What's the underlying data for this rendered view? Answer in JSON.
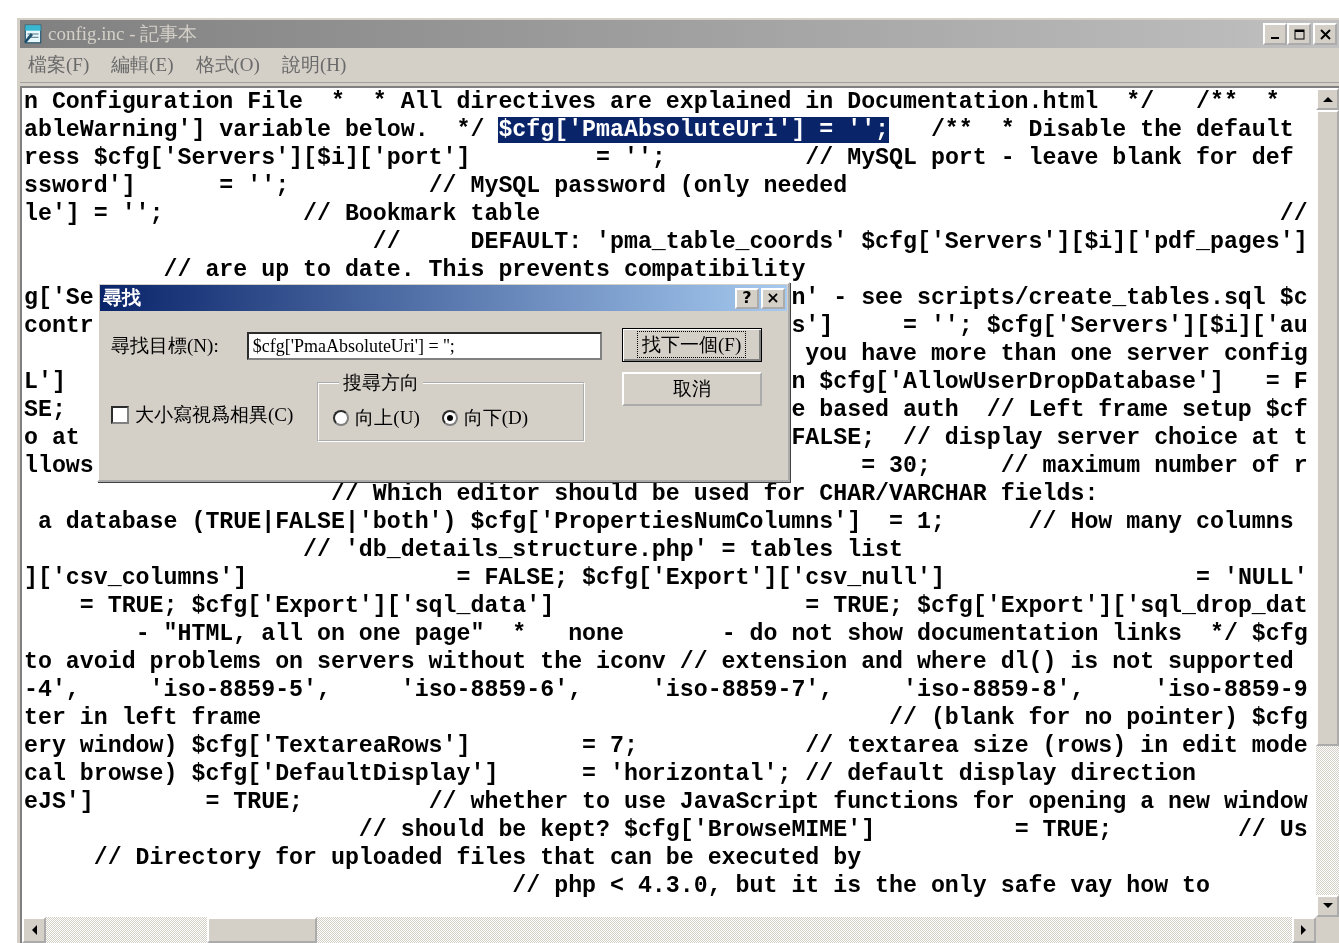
{
  "window": {
    "title": "config.inc - 記事本"
  },
  "menu": [
    "檔案(F)",
    "編輯(E)",
    "格式(O)",
    "說明(H)"
  ],
  "editor": {
    "lines": [
      [
        {
          "text": "n Configuration File  *  * All directives are explained in Documentation.html  */   /**  *",
          "selected": false
        }
      ],
      [
        {
          "text": "ableWarning'] variable below.  */ ",
          "selected": false
        },
        {
          "text": "$cfg['PmaAbsoluteUri'] = '';",
          "selected": true
        },
        {
          "text": "   /**  * Disable the default",
          "selected": false
        }
      ],
      [
        {
          "text": "ress $cfg['Servers'][$i]['port']         = '';          // MySQL port - leave blank for def",
          "selected": false
        }
      ],
      [
        {
          "text": "ssword']      = '';          // MySQL password (only needed",
          "selected": false
        }
      ],
      [
        {
          "text": "le'] = '';          // Bookmark table                                                     //",
          "selected": false
        }
      ],
      [
        {
          "text": "                         //     DEFAULT: 'pma_table_coords' $cfg['Servers'][$i]['pdf_pages']",
          "selected": false
        }
      ],
      [
        {
          "text": "          // are up to date. This prevents compatibility",
          "selected": false
        }
      ],
      [
        {
          "text": "g['Se                                                  n' - see scripts/create_tables.sql $c",
          "selected": false
        }
      ],
      [
        {
          "text": "contr                                                  s']     = ''; $cfg['Servers'][$i]['au",
          "selected": false
        }
      ],
      [
        {
          "text": "                                                        you have more than one server config",
          "selected": false
        }
      ],
      [
        {
          "text": "L']                                                    n $cfg['AllowUserDropDatabase']   = F",
          "selected": false
        }
      ],
      [
        {
          "text": "SE;                                                    e based auth  // Left frame setup $cf",
          "selected": false
        }
      ],
      [
        {
          "text": "o at                                                   FALSE;  // display server choice at t",
          "selected": false
        }
      ],
      [
        {
          "text": "llows                                                       = 30;     // maximum number of r",
          "selected": false
        }
      ],
      [
        {
          "text": "                      // Which editor should be used for CHAR/VARCHAR fields:",
          "selected": false
        }
      ],
      [
        {
          "text": " a database (TRUE|FALSE|'both') $cfg['PropertiesNumColumns']  = 1;      // How many columns",
          "selected": false
        }
      ],
      [
        {
          "text": "                    // 'db_details_structure.php' = tables list",
          "selected": false
        }
      ],
      [
        {
          "text": "]['csv_columns']               = FALSE; $cfg['Export']['csv_null']                  = 'NULL'",
          "selected": false
        }
      ],
      [
        {
          "text": "    = TRUE; $cfg['Export']['sql_data']                  = TRUE; $cfg['Export']['sql_drop_dat",
          "selected": false
        }
      ],
      [
        {
          "text": "        - \"HTML, all on one page\"  *   none       - do not show documentation links  */ $cfg",
          "selected": false
        }
      ],
      [
        {
          "text": "to avoid problems on servers without the iconv // extension and where dl() is not supported",
          "selected": false
        }
      ],
      [
        {
          "text": "-4',     'iso-8859-5',     'iso-8859-6',     'iso-8859-7',     'iso-8859-8',     'iso-8859-9",
          "selected": false
        }
      ],
      [
        {
          "text": "ter in left frame                                             // (blank for no pointer) $cfg",
          "selected": false
        }
      ],
      [
        {
          "text": "ery window) $cfg['TextareaRows']        = 7;            // textarea size (rows) in edit mode",
          "selected": false
        }
      ],
      [
        {
          "text": "cal browse) $cfg['DefaultDisplay']      = 'horizontal'; // default display direction",
          "selected": false
        }
      ],
      [
        {
          "text": "eJS']        = TRUE;         // whether to use JavaScript functions for opening a new window",
          "selected": false
        }
      ],
      [
        {
          "text": "                        // should be kept? $cfg['BrowseMIME']          = TRUE;         // Us",
          "selected": false
        }
      ],
      [
        {
          "text": "     // Directory for uploaded files that can be executed by",
          "selected": false
        }
      ],
      [
        {
          "text": "                                   // php < 4.3.0, but it is the only safe vay how to",
          "selected": false
        }
      ]
    ]
  },
  "find_dialog": {
    "title": "尋找",
    "help": "?",
    "close": "×",
    "find_label": "尋找目標(N):",
    "find_value": "$cfg['PmaAbsoluteUri'] = '';",
    "buttons": [
      {
        "label": "找下一個(F)",
        "default": true
      },
      {
        "label": "取消",
        "default": false
      }
    ],
    "direction": {
      "title": "搜尋方向",
      "options": [
        {
          "label": "向上(U)",
          "selected": false
        },
        {
          "label": "向下(D)",
          "selected": true
        }
      ]
    },
    "match_case": {
      "label": "大小寫視爲相異(C)",
      "checked": false
    }
  }
}
